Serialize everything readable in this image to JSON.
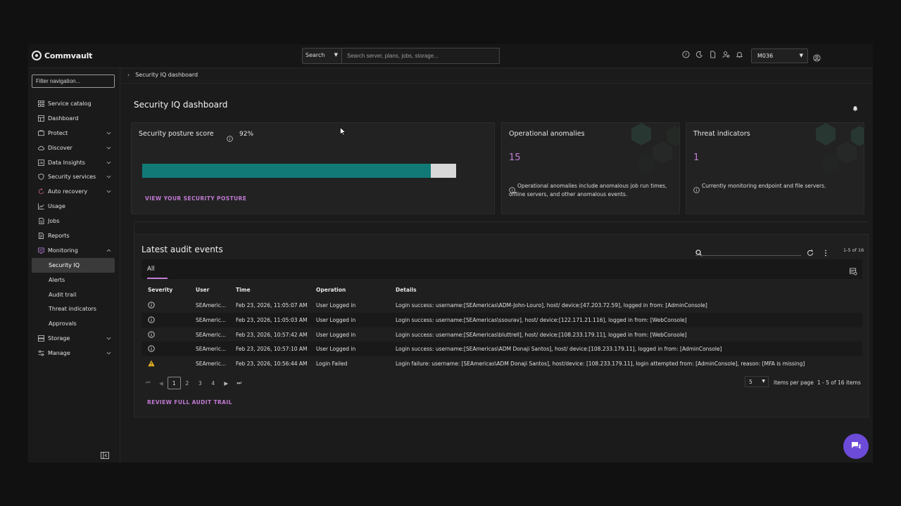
{
  "app": {
    "logo_text": "Commvault",
    "search_type": "Search",
    "search_placeholder": "Search server, plans, jobs, storage...",
    "company": "M036"
  },
  "sidebar": {
    "filter_placeholder": "Filter navigation...",
    "items": [
      {
        "label": "Service catalog",
        "icon": "grid-icon",
        "expandable": false
      },
      {
        "label": "Dashboard",
        "icon": "dashboard-icon",
        "expandable": false
      },
      {
        "label": "Protect",
        "icon": "protect-icon",
        "expandable": true
      },
      {
        "label": "Discover",
        "icon": "cloud-icon",
        "expandable": true
      },
      {
        "label": "Data Insights",
        "icon": "insights-icon",
        "expandable": true
      },
      {
        "label": "Security services",
        "icon": "shield-icon",
        "expandable": true
      },
      {
        "label": "Auto recovery",
        "icon": "recovery-icon",
        "expandable": true
      },
      {
        "label": "Usage",
        "icon": "chart-icon",
        "expandable": false
      },
      {
        "label": "Jobs",
        "icon": "jobs-icon",
        "expandable": false
      },
      {
        "label": "Reports",
        "icon": "reports-icon",
        "expandable": false
      },
      {
        "label": "Monitoring",
        "icon": "monitoring-icon",
        "expandable": true,
        "expanded": true
      }
    ],
    "monitoring_sub": [
      {
        "label": "Security IQ",
        "active": true
      },
      {
        "label": "Alerts"
      },
      {
        "label": "Audit trail"
      },
      {
        "label": "Threat indicators"
      },
      {
        "label": "Approvals"
      }
    ],
    "bottom_items": [
      {
        "label": "Storage",
        "icon": "storage-icon",
        "expandable": true
      },
      {
        "label": "Manage",
        "icon": "manage-icon",
        "expandable": true
      }
    ]
  },
  "breadcrumb": {
    "current": "Security IQ dashboard"
  },
  "page": {
    "title": "Security IQ dashboard"
  },
  "posture": {
    "title": "Security posture score",
    "score_label": "92%",
    "score_value": 0.92,
    "link": "VIEW YOUR SECURITY POSTURE"
  },
  "anomalies": {
    "title": "Operational anomalies",
    "count": "15",
    "description": "Operational anomalies include anomalous job run times, offline servers, and other anomalous events."
  },
  "threats": {
    "title": "Threat indicators",
    "count": "1",
    "description": "Currently monitoring endpoint and file servers."
  },
  "audit": {
    "title": "Latest audit events",
    "count_label": "1-5 of 16",
    "tab": "All",
    "columns": [
      "Severity",
      "User",
      "Time",
      "Operation",
      "Details"
    ],
    "rows": [
      {
        "severity": "info",
        "user": "SEAmeric...",
        "time": "Feb 23, 2026, 11:05:07 AM",
        "operation": "User Logged in",
        "details": "Login success: username:[SEAmericas\\ADM-John-Louro], host/ device:[47.203.72.59], logged in from: [AdminConsole]"
      },
      {
        "severity": "info",
        "user": "SEAmeric...",
        "time": "Feb 23, 2026, 11:05:03 AM",
        "operation": "User Logged in",
        "details": "Login success: username:[SEAmericas\\ssourav], host/ device:[122.171.21.116], logged in from: [WebConsole]"
      },
      {
        "severity": "info",
        "user": "SEAmeric...",
        "time": "Feb 23, 2026, 10:57:42 AM",
        "operation": "User Logged in",
        "details": "Login success: username:[SEAmericas\\bluttrell], host/ device:[108.233.179.11], logged in from: [WebConsole]"
      },
      {
        "severity": "info",
        "user": "SEAmeric...",
        "time": "Feb 23, 2026, 10:57:10 AM",
        "operation": "User Logged in",
        "details": "Login success: username:[SEAmericas\\ADM Donaji Santos], host/ device:[108.233.179.11], logged in from: [AdminConsole]"
      },
      {
        "severity": "warning",
        "user": "SEAmeric...",
        "time": "Feb 23, 2026, 10:56:44 AM",
        "operation": "Login Failed",
        "details": "Login failure: username: [SEAmericas\\ADM Donaji Santos], host/device: [108.233.179.11], login attempted from: [AdminConsole], reason: [MFA is missing]"
      }
    ],
    "pages": [
      "1",
      "2",
      "3",
      "4"
    ],
    "current_page": "1",
    "per_page": "5",
    "per_page_label": "items per page",
    "range_label": "1 - 5 of 16 items",
    "review_link": "REVIEW FULL AUDIT TRAIL"
  },
  "colors": {
    "accent": "#c27ed4",
    "progress": "#117a76",
    "warning": "#e6b422",
    "chat": "#6c4bd8"
  }
}
